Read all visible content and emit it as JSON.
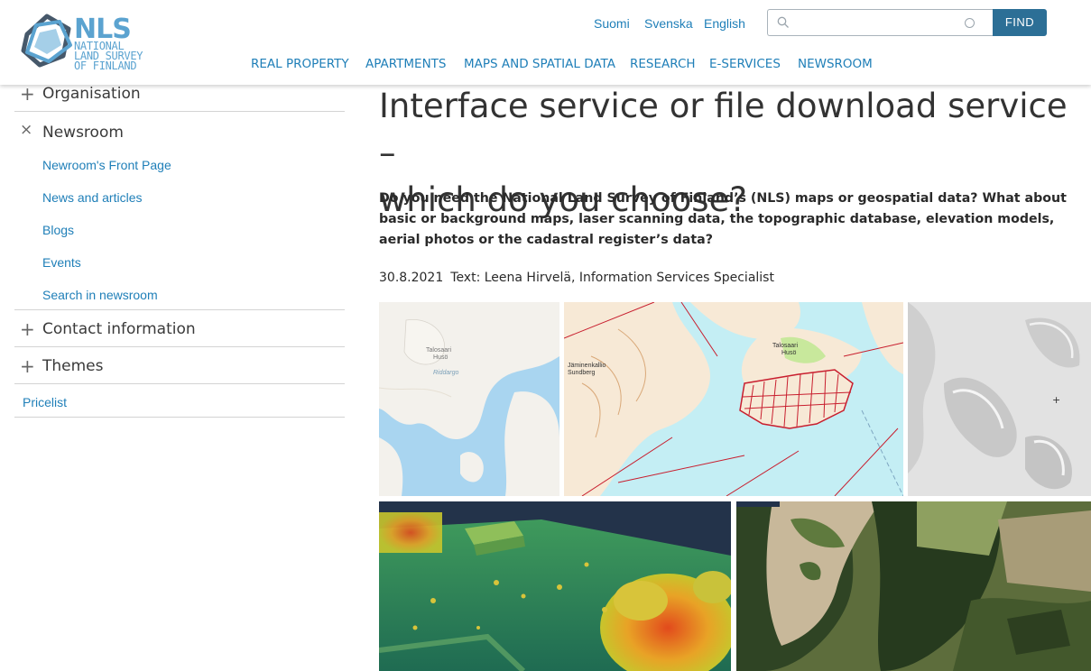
{
  "logo": {
    "short": "NLS",
    "lines": [
      "NATIONAL",
      "LAND SURVEY",
      "OF FINLAND"
    ]
  },
  "languages": [
    "Suomi",
    "Svenska",
    "English"
  ],
  "search": {
    "placeholder": "",
    "button": "FIND"
  },
  "mainnav": [
    "REAL PROPERTY",
    "APARTMENTS",
    "MAPS AND SPATIAL DATA",
    "RESEARCH",
    "E-SERVICES",
    "NEWSROOM"
  ],
  "sidebar": {
    "organisation": "Organisation",
    "newsroom": "Newsroom",
    "newsroom_items": [
      "Newroom's Front Page",
      "News and articles",
      "Blogs",
      "Events",
      "Search in newsroom"
    ],
    "contact": "Contact information",
    "themes": "Themes",
    "pricelist": "Pricelist"
  },
  "article": {
    "title_line1": "Interface service or file download service –",
    "title_line2": "which do you choose?",
    "lead": "Do you need the National Land Survey of Finland’s (NLS) maps or geospatial data? What about basic or background maps, laser scanning data, the topographic database, elevation models, aerial photos or the cadastral register’s data?",
    "date": "30.8.2021",
    "author": "Text: Leena Hirvelä, Information Services Specialist"
  },
  "map_labels": {
    "map1_talosaari": "Talosaari",
    "map1_huso": "Husö",
    "map1_riddarvik": "Riddargo",
    "map2_talosaari": "Talosaari",
    "map2_huso": "Husö",
    "map2_jaminkallio": "Jäminenkallio",
    "map2_sundberg": "Sundberg"
  },
  "colors": {
    "link": "#1f7fb8",
    "find_button": "#2c6f96",
    "logo": "#5ba3d0"
  }
}
